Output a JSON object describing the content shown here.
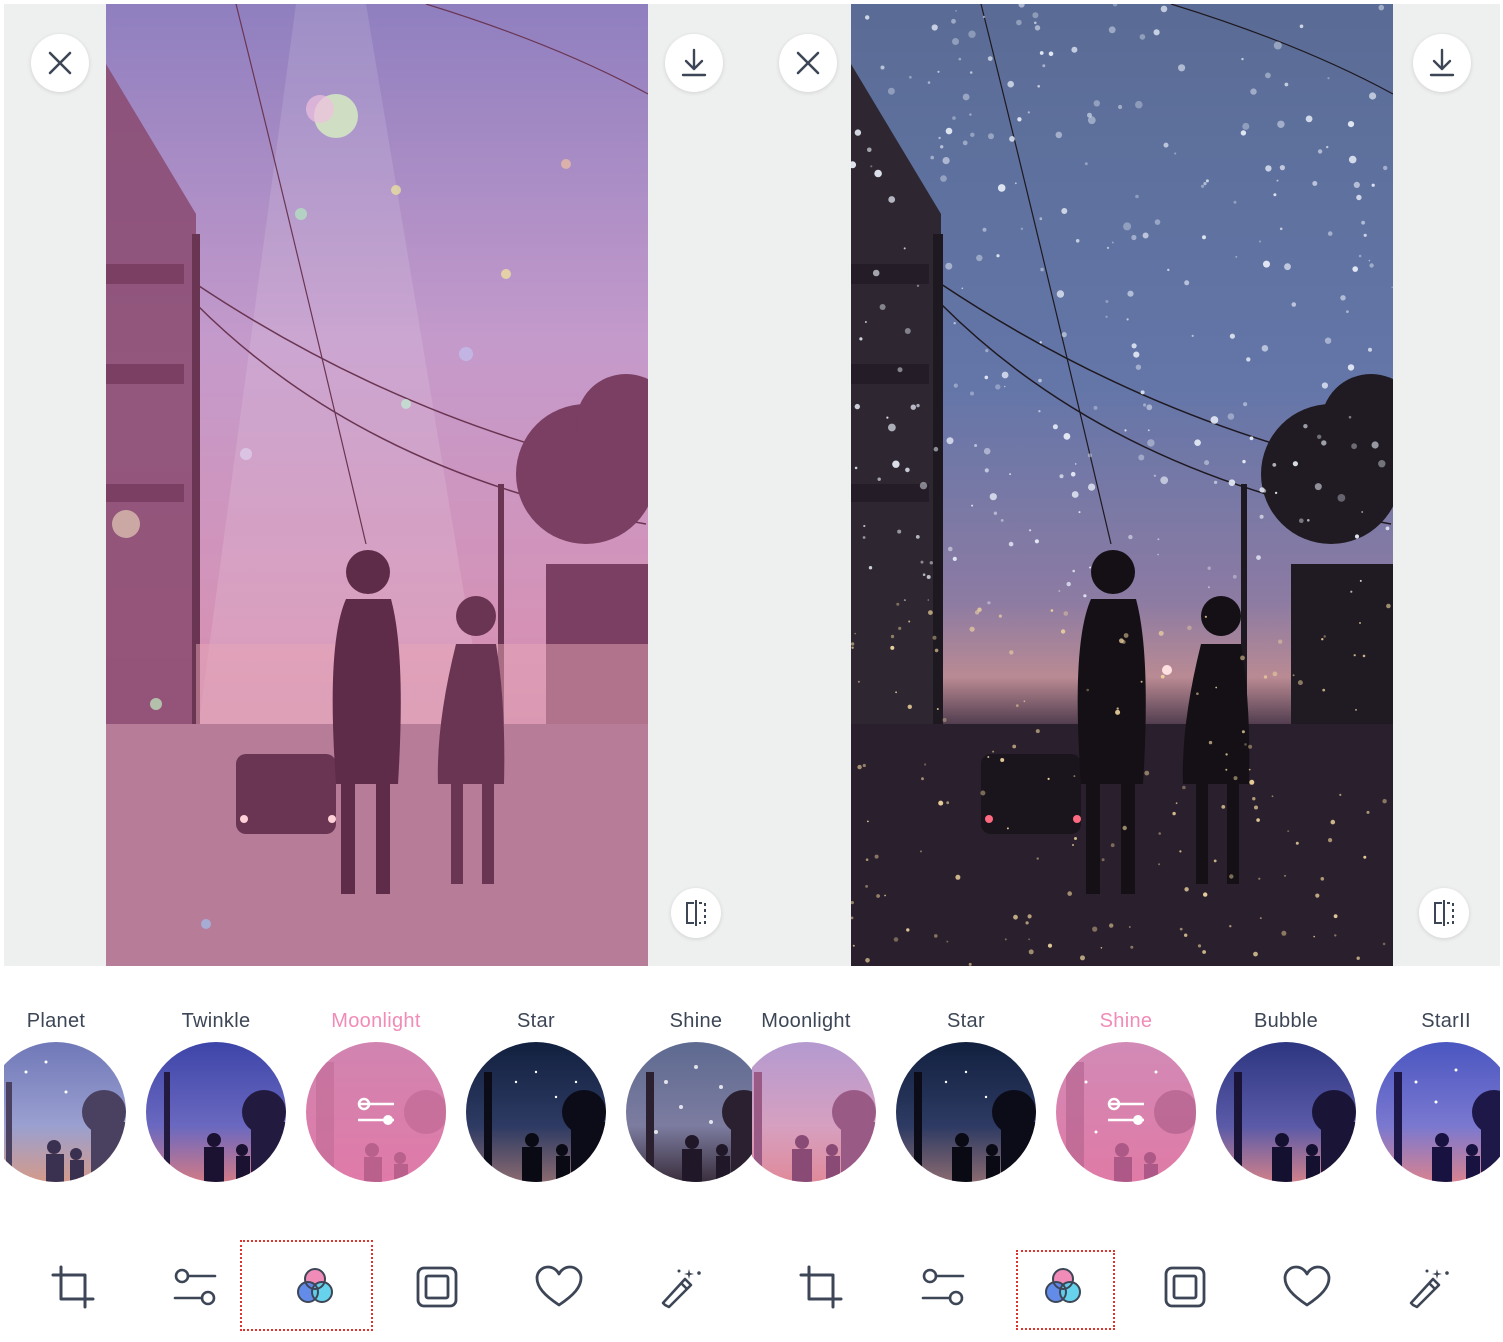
{
  "icons": {
    "close": "close-icon",
    "download": "download-icon",
    "compare": "compare-icon",
    "crop": "crop-icon",
    "adjust": "sliders-icon",
    "filter": "filter-circles-icon",
    "frame": "frame-icon",
    "favorite": "heart-icon",
    "magic": "magic-wand-icon",
    "thumb_settings": "sliders-icon"
  },
  "colors": {
    "active_label": "#f08cb7",
    "label": "#3d4656",
    "icon": "#3d4656",
    "highlight": "#e0332c",
    "canvas_bg": "#eeefef"
  },
  "left_screen": {
    "active_filter": "Moonlight",
    "filters": [
      {
        "label": "Planet",
        "active": false
      },
      {
        "label": "Twinkle",
        "active": false
      },
      {
        "label": "Moonlight",
        "active": true
      },
      {
        "label": "Star",
        "active": false
      },
      {
        "label": "Shine",
        "active": false
      }
    ],
    "toolbar": [
      "crop",
      "adjust",
      "filter",
      "frame",
      "favorite",
      "magic"
    ],
    "selected_tool": "filter"
  },
  "right_screen": {
    "active_filter": "Shine",
    "filters": [
      {
        "label": "Moonlight",
        "active": false
      },
      {
        "label": "Star",
        "active": false
      },
      {
        "label": "Shine",
        "active": true
      },
      {
        "label": "Bubble",
        "active": false
      },
      {
        "label": "StarII",
        "active": false
      }
    ],
    "toolbar": [
      "crop",
      "adjust",
      "filter",
      "frame",
      "favorite",
      "magic"
    ],
    "selected_tool": "filter"
  }
}
